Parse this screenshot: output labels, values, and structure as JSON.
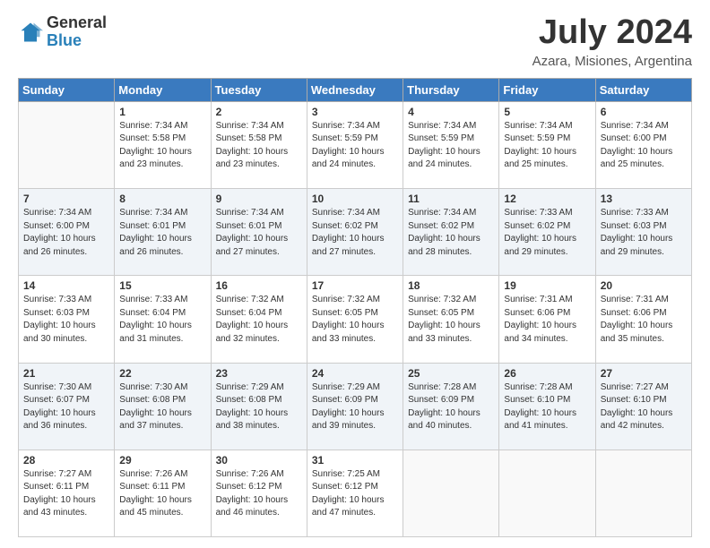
{
  "header": {
    "logo_general": "General",
    "logo_blue": "Blue",
    "title": "July 2024",
    "subtitle": "Azara, Misiones, Argentina"
  },
  "weekdays": [
    "Sunday",
    "Monday",
    "Tuesday",
    "Wednesday",
    "Thursday",
    "Friday",
    "Saturday"
  ],
  "weeks": [
    [
      {
        "day": "",
        "info": ""
      },
      {
        "day": "1",
        "info": "Sunrise: 7:34 AM\nSunset: 5:58 PM\nDaylight: 10 hours\nand 23 minutes."
      },
      {
        "day": "2",
        "info": "Sunrise: 7:34 AM\nSunset: 5:58 PM\nDaylight: 10 hours\nand 23 minutes."
      },
      {
        "day": "3",
        "info": "Sunrise: 7:34 AM\nSunset: 5:59 PM\nDaylight: 10 hours\nand 24 minutes."
      },
      {
        "day": "4",
        "info": "Sunrise: 7:34 AM\nSunset: 5:59 PM\nDaylight: 10 hours\nand 24 minutes."
      },
      {
        "day": "5",
        "info": "Sunrise: 7:34 AM\nSunset: 5:59 PM\nDaylight: 10 hours\nand 25 minutes."
      },
      {
        "day": "6",
        "info": "Sunrise: 7:34 AM\nSunset: 6:00 PM\nDaylight: 10 hours\nand 25 minutes."
      }
    ],
    [
      {
        "day": "7",
        "info": "Sunrise: 7:34 AM\nSunset: 6:00 PM\nDaylight: 10 hours\nand 26 minutes."
      },
      {
        "day": "8",
        "info": "Sunrise: 7:34 AM\nSunset: 6:01 PM\nDaylight: 10 hours\nand 26 minutes."
      },
      {
        "day": "9",
        "info": "Sunrise: 7:34 AM\nSunset: 6:01 PM\nDaylight: 10 hours\nand 27 minutes."
      },
      {
        "day": "10",
        "info": "Sunrise: 7:34 AM\nSunset: 6:02 PM\nDaylight: 10 hours\nand 27 minutes."
      },
      {
        "day": "11",
        "info": "Sunrise: 7:34 AM\nSunset: 6:02 PM\nDaylight: 10 hours\nand 28 minutes."
      },
      {
        "day": "12",
        "info": "Sunrise: 7:33 AM\nSunset: 6:02 PM\nDaylight: 10 hours\nand 29 minutes."
      },
      {
        "day": "13",
        "info": "Sunrise: 7:33 AM\nSunset: 6:03 PM\nDaylight: 10 hours\nand 29 minutes."
      }
    ],
    [
      {
        "day": "14",
        "info": "Sunrise: 7:33 AM\nSunset: 6:03 PM\nDaylight: 10 hours\nand 30 minutes."
      },
      {
        "day": "15",
        "info": "Sunrise: 7:33 AM\nSunset: 6:04 PM\nDaylight: 10 hours\nand 31 minutes."
      },
      {
        "day": "16",
        "info": "Sunrise: 7:32 AM\nSunset: 6:04 PM\nDaylight: 10 hours\nand 32 minutes."
      },
      {
        "day": "17",
        "info": "Sunrise: 7:32 AM\nSunset: 6:05 PM\nDaylight: 10 hours\nand 33 minutes."
      },
      {
        "day": "18",
        "info": "Sunrise: 7:32 AM\nSunset: 6:05 PM\nDaylight: 10 hours\nand 33 minutes."
      },
      {
        "day": "19",
        "info": "Sunrise: 7:31 AM\nSunset: 6:06 PM\nDaylight: 10 hours\nand 34 minutes."
      },
      {
        "day": "20",
        "info": "Sunrise: 7:31 AM\nSunset: 6:06 PM\nDaylight: 10 hours\nand 35 minutes."
      }
    ],
    [
      {
        "day": "21",
        "info": "Sunrise: 7:30 AM\nSunset: 6:07 PM\nDaylight: 10 hours\nand 36 minutes."
      },
      {
        "day": "22",
        "info": "Sunrise: 7:30 AM\nSunset: 6:08 PM\nDaylight: 10 hours\nand 37 minutes."
      },
      {
        "day": "23",
        "info": "Sunrise: 7:29 AM\nSunset: 6:08 PM\nDaylight: 10 hours\nand 38 minutes."
      },
      {
        "day": "24",
        "info": "Sunrise: 7:29 AM\nSunset: 6:09 PM\nDaylight: 10 hours\nand 39 minutes."
      },
      {
        "day": "25",
        "info": "Sunrise: 7:28 AM\nSunset: 6:09 PM\nDaylight: 10 hours\nand 40 minutes."
      },
      {
        "day": "26",
        "info": "Sunrise: 7:28 AM\nSunset: 6:10 PM\nDaylight: 10 hours\nand 41 minutes."
      },
      {
        "day": "27",
        "info": "Sunrise: 7:27 AM\nSunset: 6:10 PM\nDaylight: 10 hours\nand 42 minutes."
      }
    ],
    [
      {
        "day": "28",
        "info": "Sunrise: 7:27 AM\nSunset: 6:11 PM\nDaylight: 10 hours\nand 43 minutes."
      },
      {
        "day": "29",
        "info": "Sunrise: 7:26 AM\nSunset: 6:11 PM\nDaylight: 10 hours\nand 45 minutes."
      },
      {
        "day": "30",
        "info": "Sunrise: 7:26 AM\nSunset: 6:12 PM\nDaylight: 10 hours\nand 46 minutes."
      },
      {
        "day": "31",
        "info": "Sunrise: 7:25 AM\nSunset: 6:12 PM\nDaylight: 10 hours\nand 47 minutes."
      },
      {
        "day": "",
        "info": ""
      },
      {
        "day": "",
        "info": ""
      },
      {
        "day": "",
        "info": ""
      }
    ]
  ]
}
